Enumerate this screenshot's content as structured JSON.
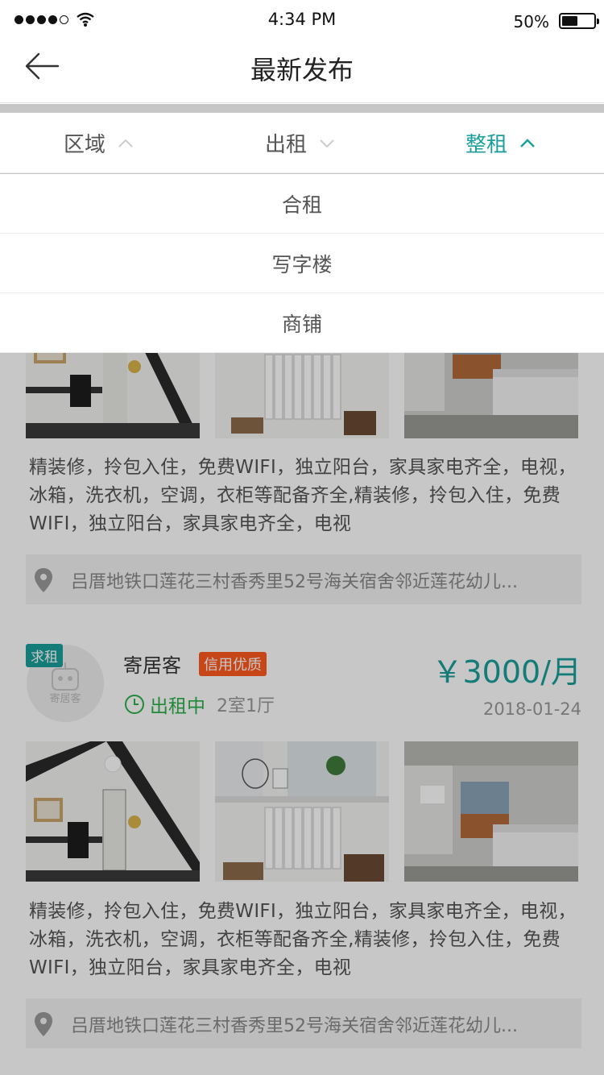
{
  "status_bar": {
    "time": "4:34 PM",
    "battery": "50%"
  },
  "nav": {
    "title": "最新发布",
    "back_icon": "back-arrow-icon"
  },
  "filters": [
    {
      "label": "区域",
      "icon": "chevron-up-icon"
    },
    {
      "label": "出租",
      "icon": "chevron-down-icon"
    },
    {
      "label": "整租",
      "icon": "chevron-up-icon",
      "active": true
    }
  ],
  "dropdown": {
    "items": [
      "合租",
      "写字楼",
      "商铺"
    ]
  },
  "colors": {
    "accent": "#1a9f9a",
    "badge": "#ff5a1f",
    "status_green": "#2bb14a"
  },
  "listings": [
    {
      "description": "精装修，拎包入住，免费WIFI，独立阳台，家具家电齐全，电视，冰箱，洗衣机，空调，衣柜等配备齐全,精装修，拎包入住，免费WIFI，独立阳台，家具家电齐全，电视",
      "address": "吕厝地铁口莲花三村香秀里52号海关宿舍邻近莲花幼儿..."
    },
    {
      "tag": "求租",
      "avatar_label": "寄居客",
      "owner": "寄居客",
      "badge": "信用优质",
      "status": "出租中",
      "room_type": "2室1厅",
      "price": "￥3000/月",
      "date": "2018-01-24",
      "description": "精装修，拎包入住，免费WIFI，独立阳台，家具家电齐全，电视，冰箱，洗衣机，空调，衣柜等配备齐全,精装修，拎包入住，免费WIFI，独立阳台，家具家电齐全，电视",
      "address": "吕厝地铁口莲花三村香秀里52号海关宿舍邻近莲花幼儿..."
    }
  ]
}
